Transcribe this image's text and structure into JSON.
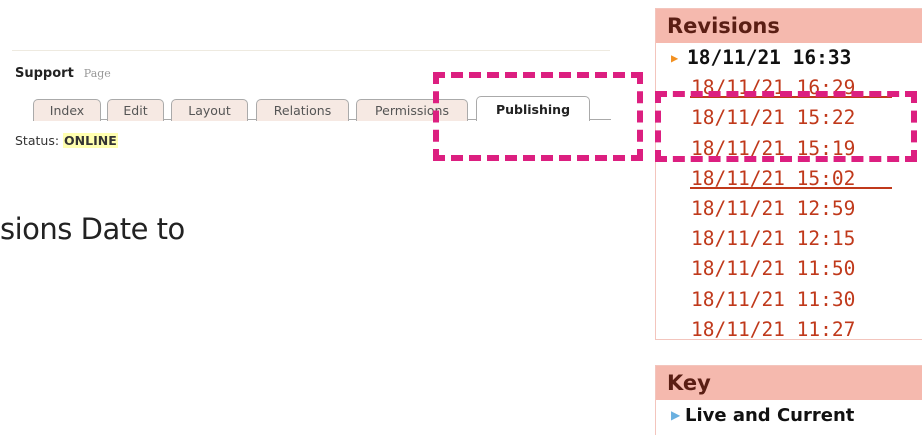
{
  "page": {
    "title": "Support",
    "type": "Page",
    "status_label": "Status:",
    "status_value": "ONLINE"
  },
  "tabs": [
    {
      "label": "Index"
    },
    {
      "label": "Edit"
    },
    {
      "label": "Layout"
    },
    {
      "label": "Relations"
    },
    {
      "label": "Permissions"
    },
    {
      "label": "Publishing"
    }
  ],
  "background_text": "sions Date to",
  "revisions": {
    "header": "Revisions",
    "items": [
      "18/11/21 16:33",
      "18/11/21 16:29",
      "18/11/21 15:22",
      "18/11/21 15:19",
      "18/11/21 15:02",
      "18/11/21 12:59",
      "18/11/21 12:15",
      "18/11/21 11:50",
      "18/11/21 11:30",
      "18/11/21 11:27"
    ]
  },
  "key": {
    "header": "Key",
    "item": "Live and Current"
  },
  "colors": {
    "annotation": "#dc1f80",
    "revision_link": "#c0391b",
    "panel_header_bg": "#f5b9ae",
    "current_marker": "#f29020"
  },
  "icons": {
    "current_marker": "triangle-right-icon",
    "key_marker": "triangle-right-icon"
  }
}
